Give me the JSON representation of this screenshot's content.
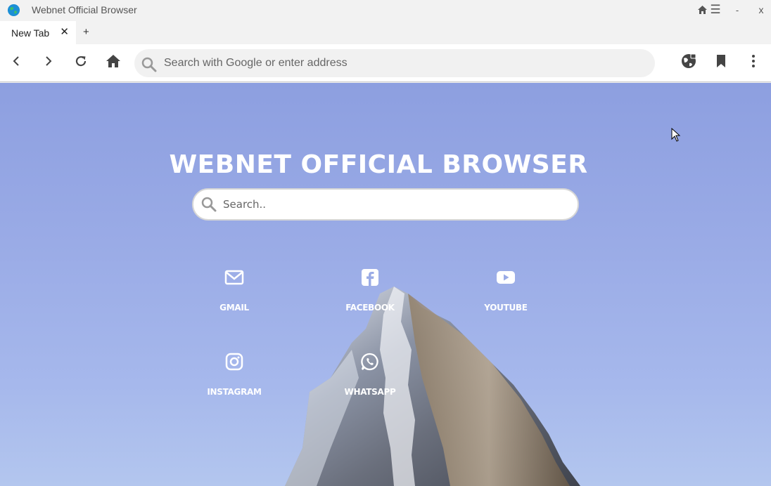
{
  "window": {
    "title": "Webnet Official Browser",
    "controls": {
      "home": "⌂",
      "menu": "☰",
      "minimize": "-",
      "close": "x"
    }
  },
  "tabs": [
    {
      "label": "New Tab",
      "close": "✕"
    }
  ],
  "new_tab_label": "+",
  "toolbar": {
    "address_placeholder": "Search with Google or enter address",
    "icons": [
      "back-icon",
      "forward-icon",
      "reload-icon",
      "home-icon",
      "vpn-globe-icon",
      "bookmark-icon",
      "more-vert-icon"
    ]
  },
  "page": {
    "title": "WEBNET OFFICIAL BROWSER",
    "search_placeholder": "Search..",
    "shortcuts": [
      {
        "label": "GMAIL",
        "icon": "envelope-icon"
      },
      {
        "label": "FACEBOOK",
        "icon": "facebook-icon"
      },
      {
        "label": "YOUTUBE",
        "icon": "youtube-icon"
      },
      {
        "label": "INSTAGRAM",
        "icon": "instagram-icon"
      },
      {
        "label": "WHATSAPP",
        "icon": "whatsapp-icon"
      }
    ]
  },
  "colors": {
    "sky_top": "#8d9fe0",
    "sky_bottom": "#b3c6ee",
    "chrome_bg": "#f2f2f2",
    "text_white": "#ffffff"
  }
}
